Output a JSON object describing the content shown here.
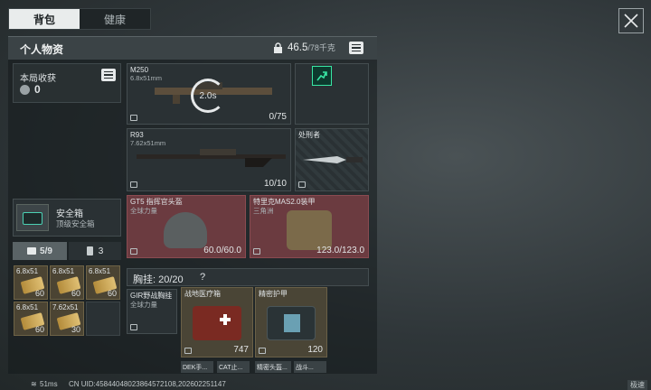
{
  "tabs": [
    "背包",
    "健康"
  ],
  "header": {
    "title": "个人物资",
    "weight": "46.5",
    "weight_max": "/78千克"
  },
  "harvest": {
    "title": "本局收获",
    "value": "0"
  },
  "safe": {
    "name": "安全箱",
    "grade": "顶级安全箱"
  },
  "subtabs": {
    "ammo": "5/9",
    "med": "3"
  },
  "ammo_cells": [
    {
      "label": "6.8x51",
      "count": "60"
    },
    {
      "label": "6.8x51",
      "count": "60"
    },
    {
      "label": "6.8x51",
      "count": "60"
    },
    {
      "label": "6.8x51",
      "count": "60"
    },
    {
      "label": "7.62x51",
      "count": "30"
    }
  ],
  "slots": {
    "primary": {
      "name": "M250",
      "caliber": "6.8x51mm",
      "timer": "2.0s",
      "ammo": "0/75"
    },
    "secondary": {
      "name": "R93",
      "caliber": "7.62x51mm",
      "ammo": "10/10"
    },
    "melee": {
      "name": "处刑者"
    },
    "helmet": {
      "name": "GT5 指挥官头盔",
      "faction": "全球力量",
      "durability": "60.0/60.0"
    },
    "armor": {
      "name": "特里克MAS2.0装甲",
      "faction": "三角洲",
      "durability": "123.0/123.0"
    }
  },
  "chest": {
    "label": "胸挂: 20/20",
    "help": "?"
  },
  "rig": {
    "name": "GIR野战胸挂",
    "faction": "全球力量"
  },
  "items": [
    {
      "name": "战地医疗箱",
      "value": "747"
    },
    {
      "name": "精密护甲",
      "value": "120"
    }
  ],
  "bottom_items": [
    "DEK手...",
    "CAT止...",
    "精密头盔...",
    "战斗..."
  ],
  "status": {
    "ping": "51ms",
    "uid": "CN UID:45844048023864572108,202602251147",
    "right": "极速"
  }
}
